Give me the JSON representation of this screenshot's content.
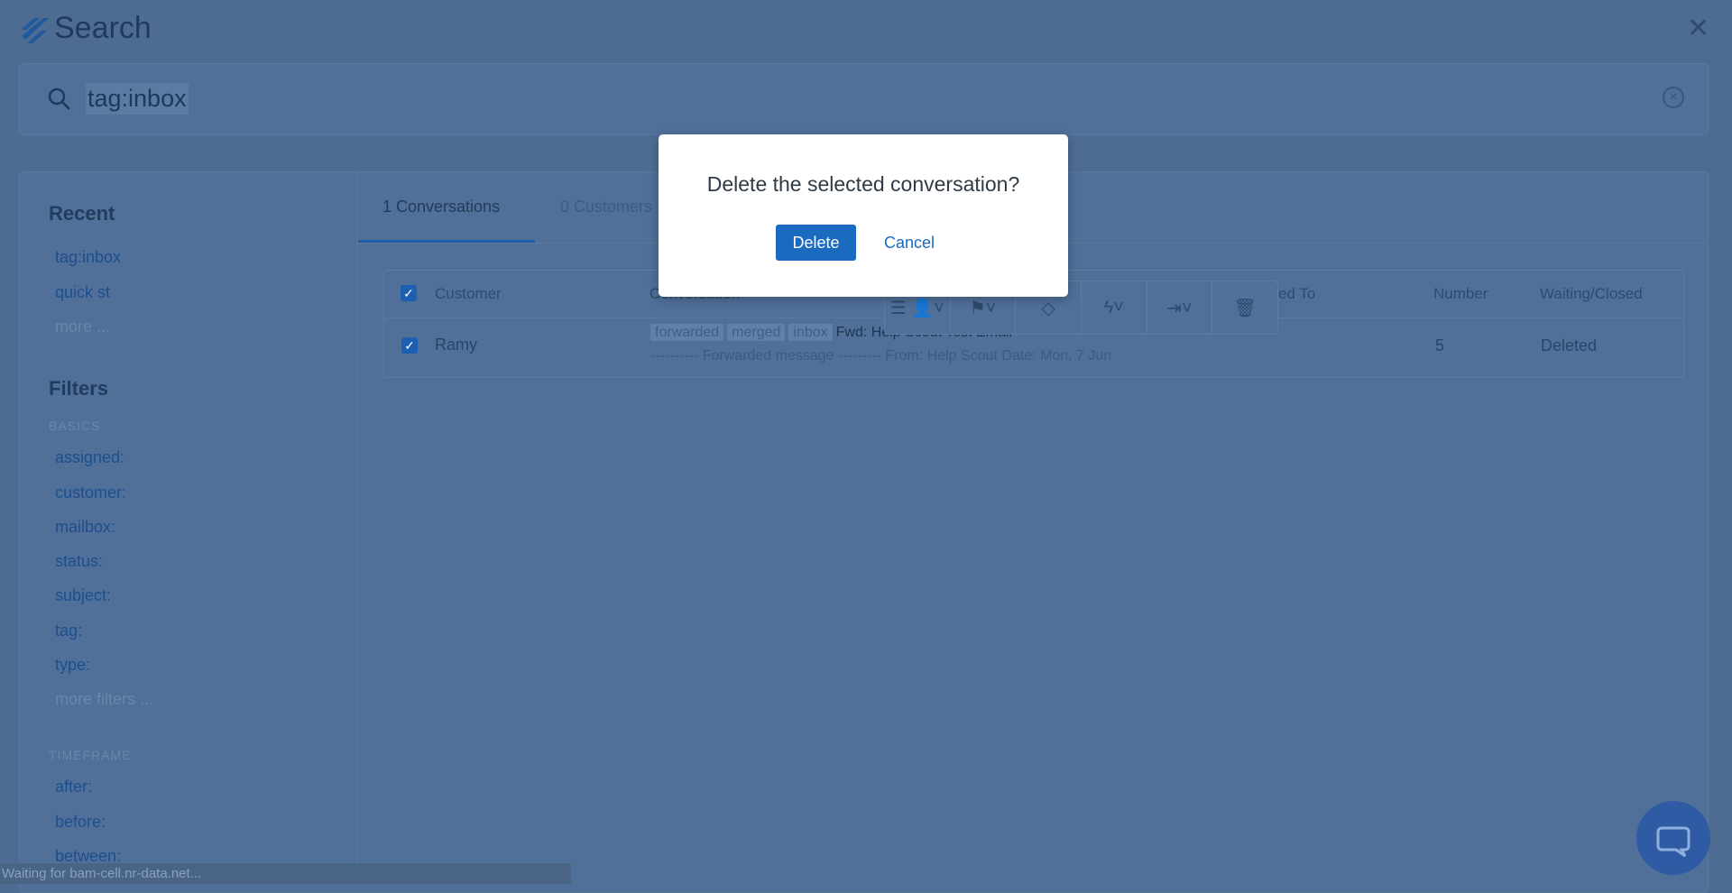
{
  "header": {
    "title": "Search",
    "close_icon": "close-icon",
    "logo": "help-scout-logo"
  },
  "search": {
    "value": "tag:inbox",
    "clear_icon": "clear-circle-icon"
  },
  "sidebar": {
    "recent_title": "Recent",
    "recent": [
      "tag:inbox",
      "quick st"
    ],
    "recent_more": "more ...",
    "filters_title": "Filters",
    "basics_label": "BASICS",
    "basics": [
      "assigned:",
      "customer:",
      "mailbox:",
      "status:",
      "subject:",
      "tag:",
      "type:"
    ],
    "more_filters": "more filters ...",
    "timeframe_label": "TIMEFRAME",
    "timeframe": [
      "after:",
      "before:",
      "between:"
    ]
  },
  "tabs": [
    {
      "label": "1 Conversations",
      "active": true
    },
    {
      "label": "0 Customers",
      "active": false
    }
  ],
  "table": {
    "columns": [
      "Customer",
      "Conversation",
      "Assigned To",
      "Number",
      "Waiting/Closed"
    ],
    "rows": [
      {
        "checked": true,
        "customer": "Ramy",
        "tags": [
          "forwarded",
          "merged",
          "inbox"
        ],
        "subject": "Fwd: Help Scout Test Email",
        "preview": "---------- Forwarded message --------- From: Help Scout Date: Mon, 7 Jun",
        "number": "5",
        "status": "Deleted"
      }
    ]
  },
  "bulk_toolbar": {
    "icons": [
      "assign-icon",
      "flag-icon",
      "tag-icon",
      "workflow-icon",
      "move-icon",
      "trash-icon"
    ]
  },
  "dialog": {
    "title": "Delete the selected conversation?",
    "confirm": "Delete",
    "cancel": "Cancel"
  },
  "status_bar": "Waiting for bam-cell.nr-data.net...",
  "colors": {
    "accent": "#1a6bc0",
    "overlay": "#4e6c92"
  }
}
